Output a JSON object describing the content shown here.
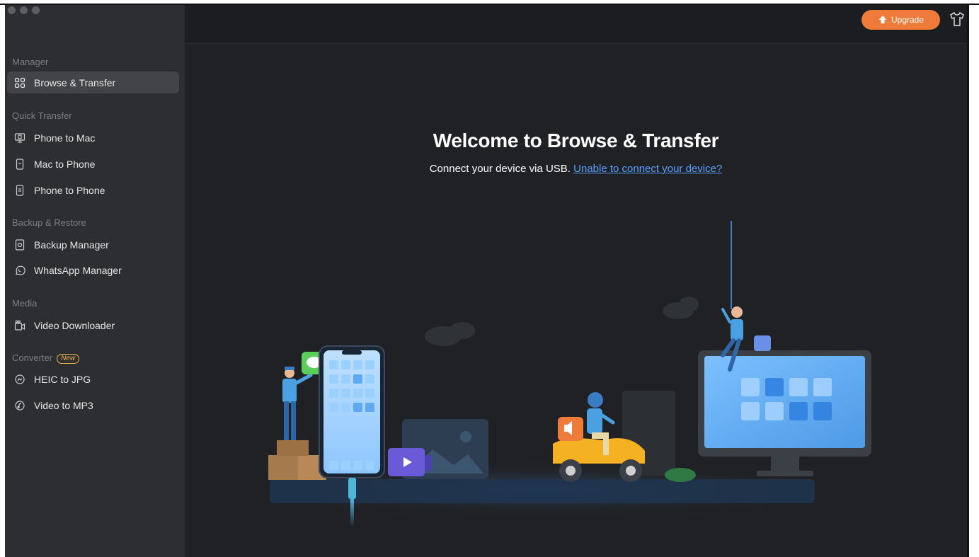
{
  "sidebar": {
    "sections": [
      {
        "title": "Manager",
        "items": [
          {
            "label": "Browse & Transfer",
            "icon": "grid-icon",
            "active": true
          }
        ]
      },
      {
        "title": "Quick Transfer",
        "items": [
          {
            "label": "Phone to Mac",
            "icon": "phone-to-mac-icon"
          },
          {
            "label": "Mac to Phone",
            "icon": "mac-to-phone-icon"
          },
          {
            "label": "Phone to Phone",
            "icon": "phone-to-phone-icon"
          }
        ]
      },
      {
        "title": "Backup & Restore",
        "items": [
          {
            "label": "Backup Manager",
            "icon": "backup-icon"
          },
          {
            "label": "WhatsApp Manager",
            "icon": "whatsapp-icon"
          }
        ]
      },
      {
        "title": "Media",
        "items": [
          {
            "label": "Video Downloader",
            "icon": "video-download-icon"
          }
        ]
      },
      {
        "title": "Converter",
        "badge": "New",
        "items": [
          {
            "label": "HEIC to JPG",
            "icon": "heic-icon"
          },
          {
            "label": "Video to MP3",
            "icon": "mp3-icon"
          }
        ]
      }
    ]
  },
  "topbar": {
    "upgrade_label": "Upgrade",
    "upgrade_icon": "upgrade-arrow-icon",
    "theme_icon": "shirt-icon"
  },
  "main": {
    "title": "Welcome to Browse & Transfer",
    "subtitle": "Connect your device via USB.",
    "link": "Unable to connect your device?"
  },
  "colors": {
    "accent": "#ee7b3a",
    "link": "#5aa0ff",
    "sidebar_bg": "#2d2e31",
    "main_bg": "#202124"
  }
}
